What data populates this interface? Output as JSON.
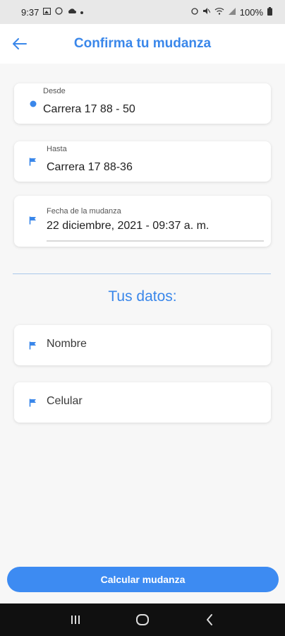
{
  "status_bar": {
    "time": "9:37",
    "battery": "100%"
  },
  "header": {
    "title": "Confirma tu mudanza",
    "back_icon": "arrow-left-icon"
  },
  "colors": {
    "accent": "#3a87ea",
    "button": "#3d8bf2",
    "background": "#f7f7f7"
  },
  "route": {
    "from": {
      "label": "Desde",
      "value": "Carrera 17 88 - 50",
      "icon": "dot-icon"
    },
    "to": {
      "label": "Hasta",
      "value": "Carrera 17 88-36",
      "icon": "flag-icon"
    },
    "date": {
      "label": "Fecha de la mudanza",
      "value": "22 diciembre, 2021 - 09:37 a. m.",
      "icon": "flag-icon"
    }
  },
  "section": {
    "title": "Tus datos:"
  },
  "form": {
    "name_placeholder": "Nombre",
    "phone_placeholder": "Celular"
  },
  "actions": {
    "submit_label": "Calcular mudanza"
  },
  "system_nav": {
    "recent_icon": "recent-apps-icon",
    "home_icon": "home-icon",
    "back_icon": "back-chevron-icon"
  }
}
